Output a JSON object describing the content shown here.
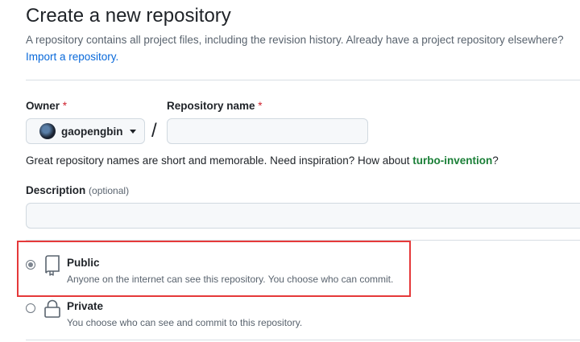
{
  "page": {
    "title": "Create a new repository",
    "intro": "A repository contains all project files, including the revision history. Already have a project repository elsewhere?",
    "import_link": "Import a repository."
  },
  "owner": {
    "label": "Owner",
    "required_mark": "*",
    "selected": "gaopengbin"
  },
  "repo_name": {
    "label": "Repository name",
    "required_mark": "*",
    "value": "",
    "separator": "/"
  },
  "hint": {
    "text": "Great repository names are short and memorable. Need inspiration? How about ",
    "suggestion": "turbo-invention",
    "suffix": "?"
  },
  "description": {
    "label": "Description",
    "optional": "(optional)",
    "value": ""
  },
  "visibility": {
    "selected": "public",
    "options": [
      {
        "title": "Public",
        "desc": "Anyone on the internet can see this repository. You choose who can commit.",
        "icon": "repo-icon"
      },
      {
        "title": "Private",
        "desc": "You choose who can see and commit to this repository.",
        "icon": "lock-icon"
      }
    ]
  },
  "colors": {
    "link": "#0969da",
    "required": "#cf222e",
    "suggestion": "#1a7f37",
    "highlight_border": "#e5393a"
  }
}
